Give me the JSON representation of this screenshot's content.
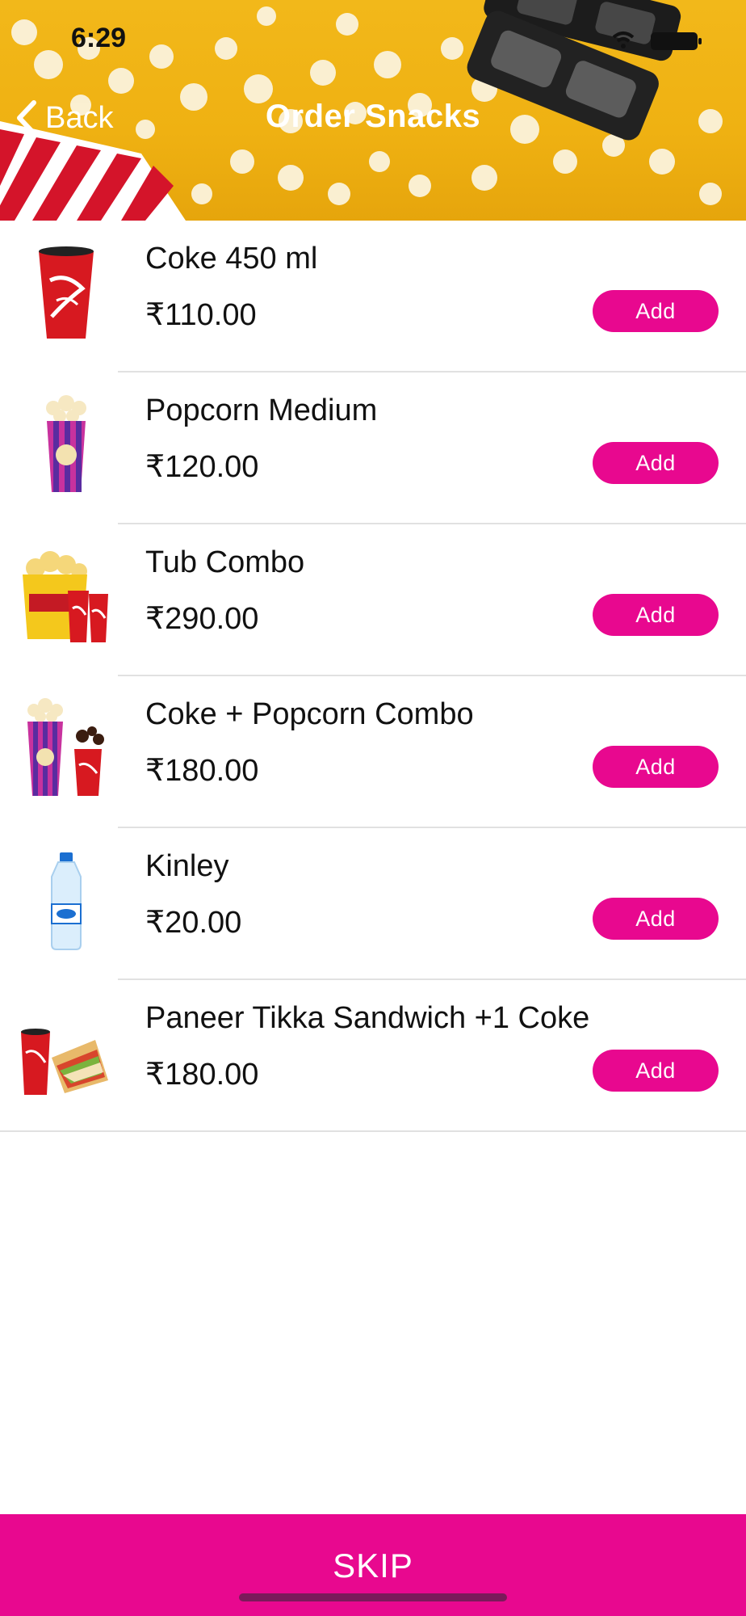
{
  "status_bar": {
    "time": "6:29"
  },
  "header": {
    "back_label": "Back",
    "title": "Order Snacks"
  },
  "items": [
    {
      "name": "Coke 450 ml",
      "price": "₹110.00",
      "add_label": "Add",
      "thumb": "coke-cup"
    },
    {
      "name": "Popcorn Medium",
      "price": "₹120.00",
      "add_label": "Add",
      "thumb": "popcorn-box"
    },
    {
      "name": "Tub Combo",
      "price": "₹290.00",
      "add_label": "Add",
      "thumb": "popcorn-tub-with-cokes"
    },
    {
      "name": "Coke + Popcorn Combo",
      "price": "₹180.00",
      "add_label": "Add",
      "thumb": "popcorn-and-coke"
    },
    {
      "name": "Kinley",
      "price": "₹20.00",
      "add_label": "Add",
      "thumb": "water-bottle"
    },
    {
      "name": "Paneer Tikka Sandwich +1 Coke",
      "price": "₹180.00",
      "add_label": "Add",
      "thumb": "coke-and-sandwich"
    }
  ],
  "footer": {
    "skip_label": "SKIP"
  },
  "colors": {
    "accent": "#e8088f",
    "header_yellow": "#f2b81a"
  }
}
